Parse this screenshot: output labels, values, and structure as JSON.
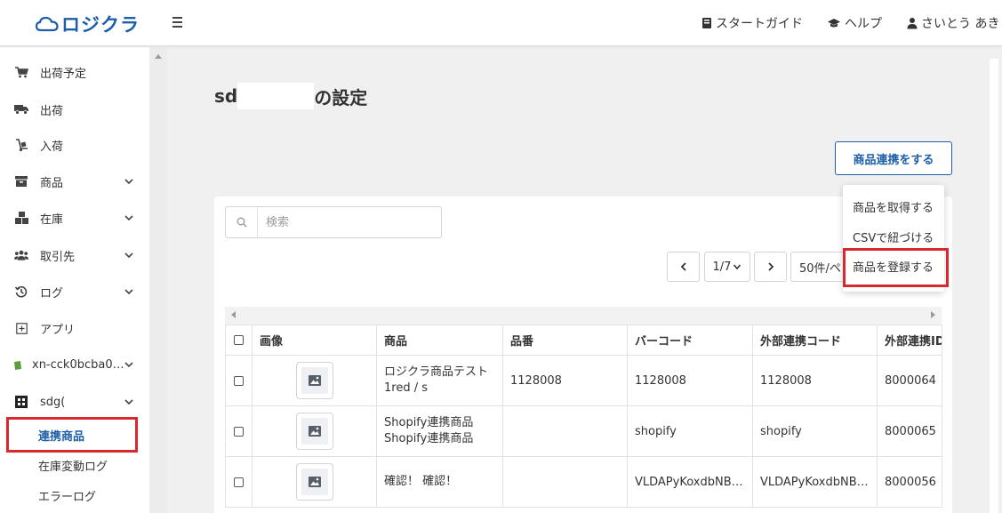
{
  "header": {
    "logo_text": "ロジクラ",
    "guide_label": "スタートガイド",
    "help_label": "ヘルプ",
    "user_label": "さいとう あき"
  },
  "sidebar": {
    "items": [
      {
        "label": "出荷予定",
        "icon": "cart-icon"
      },
      {
        "label": "出荷",
        "icon": "truck-icon"
      },
      {
        "label": "入荷",
        "icon": "dolly-icon"
      },
      {
        "label": "商品",
        "icon": "box-icon"
      },
      {
        "label": "在庫",
        "icon": "boxes-icon"
      },
      {
        "label": "取引先",
        "icon": "users-icon"
      },
      {
        "label": "ログ",
        "icon": "history-icon"
      },
      {
        "label": "アプリ",
        "icon": "plus-square-icon"
      },
      {
        "label": "xn-cck0bcba0…",
        "icon": "shopify-icon"
      },
      {
        "label": "sdg(",
        "icon": "shop-logo-icon"
      }
    ],
    "sub_items": [
      {
        "label": "連携商品"
      },
      {
        "label": "在庫変動ログ"
      },
      {
        "label": "エラーログ"
      }
    ]
  },
  "main": {
    "title_prefix": "sd",
    "title_suffix": "の設定",
    "link_button": "商品連携をする",
    "search_placeholder": "検索",
    "pagination": {
      "page": "1/7",
      "per_page": "50件/ペ"
    },
    "dropdown": [
      "商品を取得する",
      "CSVで紐づける",
      "商品を登録する"
    ],
    "table": {
      "headers": [
        "画像",
        "商品",
        "品番",
        "バーコード",
        "外部連携コード",
        "外部連携ID"
      ],
      "rows": [
        {
          "product": "ロジクラ商品テスト1red / s",
          "sku": "1128008",
          "barcode": "1128008",
          "ext_code": "1128008",
          "ext_id": "8000064"
        },
        {
          "product": "Shopify連携商品 Shopify連携商品",
          "sku": "",
          "barcode": "shopify",
          "ext_code": "shopify",
          "ext_id": "8000065"
        },
        {
          "product": "確認！ 確認！",
          "sku": "",
          "barcode": "VLDAPyKoxdbNBl…",
          "ext_code": "VLDAPyKoxdbNBl…",
          "ext_id": "8000056"
        }
      ]
    }
  },
  "colors": {
    "brand": "#1d5fa8",
    "highlight": "#d9282f"
  }
}
